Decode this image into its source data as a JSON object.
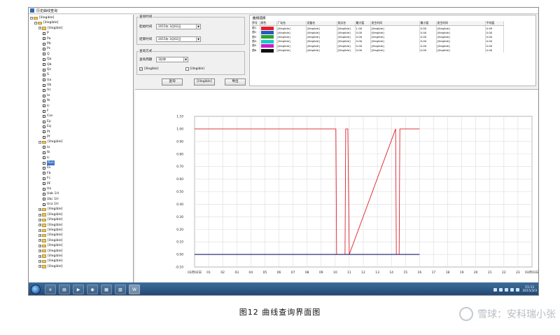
{
  "window": {
    "title": "历史曲线查询"
  },
  "tree": {
    "nodes": [
      {
        "indent": 0,
        "type": "root",
        "label": "[illegible]"
      },
      {
        "indent": 1,
        "type": "folder",
        "label": "[illegible]"
      },
      {
        "indent": 2,
        "type": "folder",
        "label": "[illegible]"
      },
      {
        "indent": 3,
        "type": "signal",
        "label": "P"
      },
      {
        "indent": 3,
        "type": "signal",
        "label": "Pa"
      },
      {
        "indent": 3,
        "type": "signal",
        "label": "Pb"
      },
      {
        "indent": 3,
        "type": "signal",
        "label": "Pc"
      },
      {
        "indent": 3,
        "type": "signal",
        "label": "Q"
      },
      {
        "indent": 3,
        "type": "signal",
        "label": "Qa"
      },
      {
        "indent": 3,
        "type": "signal",
        "label": "Qb"
      },
      {
        "indent": 3,
        "type": "signal",
        "label": "Qc"
      },
      {
        "indent": 3,
        "type": "signal",
        "label": "S"
      },
      {
        "indent": 3,
        "type": "signal",
        "label": "Ua"
      },
      {
        "indent": 3,
        "type": "signal",
        "label": "Ub"
      },
      {
        "indent": 3,
        "type": "signal",
        "label": "Uc"
      },
      {
        "indent": 3,
        "type": "signal",
        "label": "Ia"
      },
      {
        "indent": 3,
        "type": "signal",
        "label": "Ib"
      },
      {
        "indent": 3,
        "type": "signal",
        "label": "Ic"
      },
      {
        "indent": 3,
        "type": "signal",
        "label": "F"
      },
      {
        "indent": 3,
        "type": "signal",
        "label": "Cos"
      },
      {
        "indent": 3,
        "type": "signal",
        "label": "Ep"
      },
      {
        "indent": 3,
        "type": "signal",
        "label": "Eq"
      },
      {
        "indent": 3,
        "type": "signal",
        "label": "Pt"
      },
      {
        "indent": 3,
        "type": "signal",
        "label": "Pf"
      },
      {
        "indent": 2,
        "type": "folder",
        "label": "[illegible]"
      },
      {
        "indent": 3,
        "type": "signal",
        "label": "Ia"
      },
      {
        "indent": 3,
        "type": "signal",
        "label": "Ib"
      },
      {
        "indent": 3,
        "type": "signal",
        "label": "Ic"
      },
      {
        "indent": 3,
        "type": "signal",
        "label": "Run",
        "selected": true
      },
      {
        "indent": 3,
        "type": "signal",
        "label": "Fa"
      },
      {
        "indent": 3,
        "type": "signal",
        "label": "Fb"
      },
      {
        "indent": 3,
        "type": "signal",
        "label": "Fc"
      },
      {
        "indent": 3,
        "type": "signal",
        "label": "PF"
      },
      {
        "indent": 3,
        "type": "signal",
        "label": "Ua"
      },
      {
        "indent": 3,
        "type": "signal",
        "label": "Uab 1H"
      },
      {
        "indent": 3,
        "type": "signal",
        "label": "Ubc 1H"
      },
      {
        "indent": 3,
        "type": "signal",
        "label": "Uca 1H"
      },
      {
        "indent": 2,
        "type": "folder",
        "label": "[illegible]"
      },
      {
        "indent": 2,
        "type": "folder",
        "label": "[illegible]"
      },
      {
        "indent": 2,
        "type": "folder",
        "label": "[illegible]"
      },
      {
        "indent": 2,
        "type": "folder",
        "label": "[illegible]"
      },
      {
        "indent": 2,
        "type": "folder",
        "label": "[illegible]"
      },
      {
        "indent": 2,
        "type": "folder",
        "label": "[illegible]"
      },
      {
        "indent": 2,
        "type": "folder",
        "label": "[illegible]"
      },
      {
        "indent": 2,
        "type": "folder",
        "label": "[illegible]"
      },
      {
        "indent": 2,
        "type": "folder",
        "label": "[illegible]"
      },
      {
        "indent": 2,
        "type": "folder",
        "label": "[illegible]"
      },
      {
        "indent": 2,
        "type": "folder",
        "label": "[illegible]"
      },
      {
        "indent": 2,
        "type": "folder",
        "label": "[illegible]"
      }
    ]
  },
  "query": {
    "time_group": "查询时间",
    "start_label": "起始时间",
    "start_value": "2015年 3月02日",
    "end_label": "结束时间",
    "end_value": "2015年 3月02日",
    "option_group": "查询方式",
    "period_label": "查询周期",
    "period_value": "1秒钟",
    "check1": "[illegible]",
    "check1_checked": true,
    "check2": "[illegible]",
    "check2_checked": false,
    "btn_query": "查询",
    "btn_print": "[illegible]",
    "btn_export": "导出"
  },
  "curve_table": {
    "title": "曲线选择",
    "headers": [
      "序号",
      "颜色",
      "厂站名",
      "设备名",
      "测点名",
      "最大值",
      "发生时间",
      "最小值",
      "发生时间",
      "平均值"
    ],
    "rows": [
      {
        "no": "曲1",
        "color": "#e0202a",
        "station": "[illegible]",
        "device": "[illegible]",
        "point": "[illegible]",
        "max": "1.00",
        "max_time": "[illegible]",
        "min": "0.00",
        "min_time": "[illegible]",
        "avg": "0.99"
      },
      {
        "no": "曲2",
        "color": "#2858c8",
        "station": "[illegible]",
        "device": "[illegible]",
        "point": "[illegible]",
        "max": "0.00",
        "max_time": "[illegible]",
        "min": "0.00",
        "min_time": "[illegible]",
        "avg": "0.00"
      },
      {
        "no": "曲3",
        "color": "#2aa52a",
        "station": "[illegible]",
        "device": "[illegible]",
        "point": "[illegible]",
        "max": "0.00",
        "max_time": "[illegible]",
        "min": "0.00",
        "min_time": "[illegible]",
        "avg": "0.00"
      },
      {
        "no": "曲4",
        "color": "#1ec8c8",
        "station": "[illegible]",
        "device": "[illegible]",
        "point": "[illegible]",
        "max": "0.00",
        "max_time": "[illegible]",
        "min": "0.00",
        "min_time": "[illegible]",
        "avg": "0.00"
      },
      {
        "no": "曲5",
        "color": "#c820c8",
        "station": "[illegible]",
        "device": "[illegible]",
        "point": "[illegible]",
        "max": "0.00",
        "max_time": "[illegible]",
        "min": "0.00",
        "min_time": "[illegible]",
        "avg": "0.00"
      },
      {
        "no": "曲6",
        "color": "#101010",
        "station": "[illegible]",
        "device": "[illegible]",
        "point": "[illegible]",
        "max": "0.00",
        "max_time": "[illegible]",
        "min": "0.00",
        "min_time": "[illegible]",
        "avg": "0.00"
      }
    ]
  },
  "chart_data": {
    "type": "line",
    "title": "",
    "xlabel": "",
    "ylabel": "",
    "x_range": [
      0,
      24
    ],
    "ylim": [
      -0.1,
      1.1
    ],
    "y_ticks": [
      "-0.10",
      "0.00",
      "0.10",
      "0.20",
      "0.30",
      "0.40",
      "0.50",
      "0.60",
      "0.70",
      "0.80",
      "0.90",
      "1.00",
      "1.10"
    ],
    "x_tick_labels": [
      "03月02日",
      "01",
      "02",
      "03",
      "04",
      "05",
      "06",
      "07",
      "08",
      "09",
      "10",
      "11",
      "12",
      "13",
      "14",
      "15",
      "16",
      "17",
      "18",
      "19",
      "20",
      "21",
      "22",
      "23",
      "03月03日"
    ],
    "grid": true,
    "series": [
      {
        "color": "#e0202a",
        "x": [
          0,
          10.05,
          10.1,
          10.7,
          10.75,
          10.9,
          11.0,
          14.3,
          14.35,
          14.55,
          14.6,
          16.0
        ],
        "y": [
          1.0,
          1.0,
          0.0,
          0.0,
          1.0,
          1.0,
          0.0,
          1.0,
          0.0,
          0.0,
          1.0,
          1.0
        ]
      },
      {
        "color": "#1a1a6a",
        "x": [
          0,
          16.0
        ],
        "y": [
          0.0,
          0.0
        ]
      }
    ]
  },
  "taskbar": {
    "apps": [
      "ie-icon",
      "explorer-folder-icon",
      "media-player-icon",
      "chrome-icon",
      "app-icon",
      "app-icon-2",
      "monitor-app-icon"
    ],
    "clock_time": "15:11",
    "clock_date": "2015/3/3"
  },
  "caption": "图12 曲线查询界面图",
  "watermark": "雪球：安科瑞小张"
}
